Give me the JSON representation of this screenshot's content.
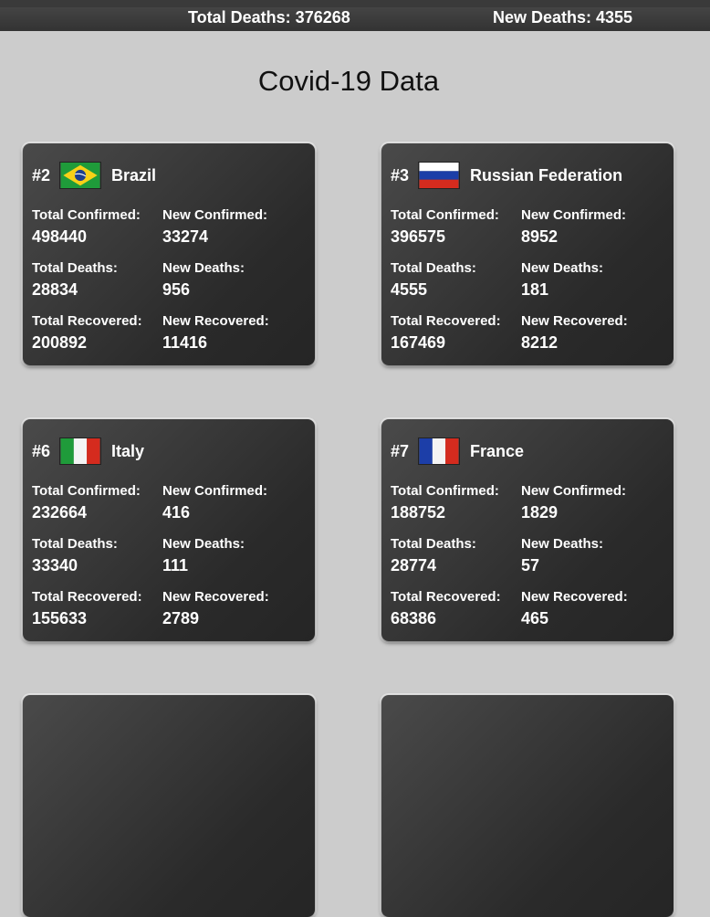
{
  "topbar": {
    "total_deaths": "Total Deaths: 376268",
    "new_deaths": "New Deaths: 4355"
  },
  "page": {
    "title": "Covid-19 Data"
  },
  "labels": {
    "total_confirmed": "Total Confirmed:",
    "new_confirmed": "New Confirmed:",
    "total_deaths": "Total Deaths:",
    "new_deaths": "New Deaths:",
    "total_recovered": "Total Recovered:",
    "new_recovered": "New Recovered:"
  },
  "cards": [
    {
      "rank": "#2",
      "name": "Brazil",
      "flag_icon": "brazil-flag-icon",
      "total_confirmed": "498440",
      "new_confirmed": "33274",
      "total_deaths": "28834",
      "new_deaths": "956",
      "total_recovered": "200892",
      "new_recovered": "11416"
    },
    {
      "rank": "#3",
      "name": "Russian Federation",
      "flag_icon": "russia-flag-icon",
      "total_confirmed": "396575",
      "new_confirmed": "8952",
      "total_deaths": "4555",
      "new_deaths": "181",
      "total_recovered": "167469",
      "new_recovered": "8212"
    },
    {
      "rank": "#6",
      "name": "Italy",
      "flag_icon": "italy-flag-icon",
      "total_confirmed": "232664",
      "new_confirmed": "416",
      "total_deaths": "33340",
      "new_deaths": "111",
      "total_recovered": "155633",
      "new_recovered": "2789"
    },
    {
      "rank": "#7",
      "name": "France",
      "flag_icon": "france-flag-icon",
      "total_confirmed": "188752",
      "new_confirmed": "1829",
      "total_deaths": "28774",
      "new_deaths": "57",
      "total_recovered": "68386",
      "new_recovered": "465"
    }
  ],
  "colors": {
    "page_bg": "#cccccc",
    "card_bg": "#333333",
    "text": "#ffffff"
  }
}
